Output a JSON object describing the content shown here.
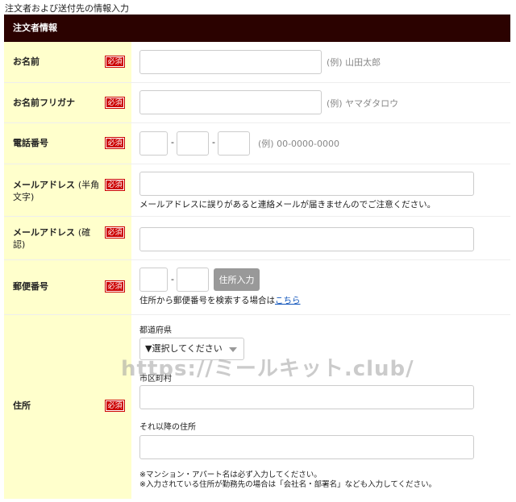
{
  "page_title": "注文者および送付先の情報入力",
  "section_header": "注文者情報",
  "required_badge": "必須",
  "fields": {
    "name": {
      "label": "お名前",
      "example": "(例) 山田太郎"
    },
    "name_kana": {
      "label": "お名前フリガナ",
      "example": "(例) ヤマダタロウ"
    },
    "phone": {
      "label": "電話番号",
      "separator": "-",
      "example": "(例) 00-0000-0000"
    },
    "email": {
      "label": "メールアドレス",
      "label_note": "(半角",
      "label_line2": "文字)",
      "note": "メールアドレスに誤りがあると連絡メールが届きませんのでご注意ください。"
    },
    "email_confirm": {
      "label": "メールアドレス",
      "label_note": "(確",
      "label_line2": "認)"
    },
    "zip": {
      "label": "郵便番号",
      "separator": "-",
      "button": "住所入力",
      "help_prefix": "住所から郵便番号を検索する場合は",
      "help_link": "こちら"
    },
    "address": {
      "label": "住所",
      "prefecture_label": "都道府県",
      "prefecture_select": "▼選択してください",
      "city_label": "市区町村",
      "rest_label": "それ以降の住所",
      "note1": "※マンション・アパート名は必ず入力してください。",
      "note2": "※入力されている住所が勤務先の場合は「会社名・部署名」なども入力してください。"
    }
  },
  "watermark": "https://ミールキット.club/"
}
